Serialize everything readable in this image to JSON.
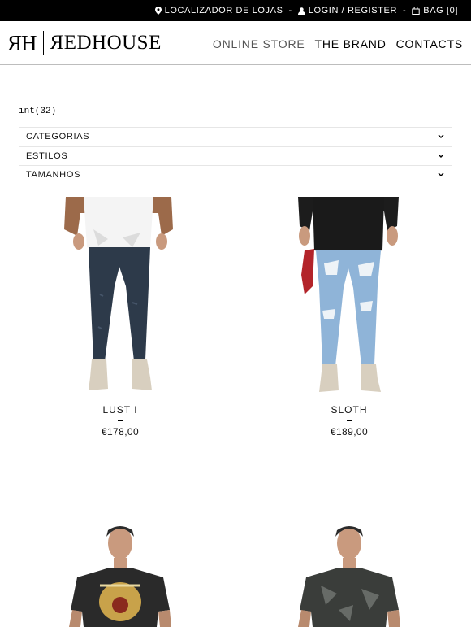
{
  "topbar": {
    "store_locator": "LOCALIZADOR DE LOJAS",
    "sep1": "-",
    "login": "LOGIN / REGISTER",
    "sep2": "-",
    "bag": "BAG [0]"
  },
  "header": {
    "logo_monogram": "ЯH",
    "logo_wordmark": "ЯEDHOUSE",
    "nav": [
      "ONLINE STORE",
      "THE BRAND",
      "CONTACTS"
    ]
  },
  "debug_text": "int(32)",
  "filters": [
    {
      "label": "CATEGORIAS"
    },
    {
      "label": "ESTILOS"
    },
    {
      "label": "TAMANHOS"
    }
  ],
  "products": [
    {
      "name": "LUST I",
      "price": "€178,00",
      "jacket": "#9c6a4a",
      "shirt": "#f4f4f4",
      "jeans": "#2d3a4a"
    },
    {
      "name": "SLOTH",
      "price": "€189,00",
      "jacket": "#1c1c1c",
      "shirt": "#1a1a1a",
      "jeans": "#8fb4d8"
    },
    {
      "name": "",
      "price": "",
      "shirt": "#2a2a2a",
      "print": "#c8a24a"
    },
    {
      "name": "",
      "price": "",
      "shirt": "#3a3d3a",
      "print": "#7a7f7a"
    }
  ],
  "colors": {
    "topbar_bg": "#000000",
    "accent": "#000000",
    "skin": "#c99a7e",
    "boots": "#d8cfbf"
  }
}
